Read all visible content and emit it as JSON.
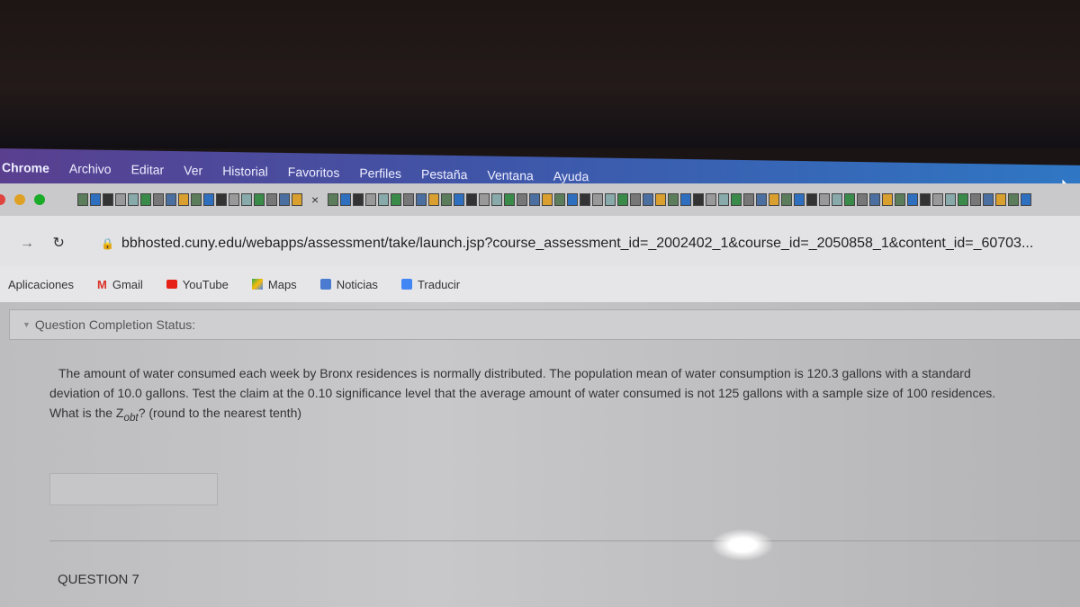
{
  "menubar": {
    "app": "Chrome",
    "items": [
      "Archivo",
      "Editar",
      "Ver",
      "Historial",
      "Favoritos",
      "Perfiles",
      "Pestaña",
      "Ventana",
      "Ayuda"
    ]
  },
  "tabs": {
    "close_label": "×"
  },
  "address": {
    "url": "bbhosted.cuny.edu/webapps/assessment/take/launch.jsp?course_assessment_id=_2002402_1&course_id=_2050858_1&content_id=_60703..."
  },
  "bookmarks": [
    {
      "label": "Aplicaciones",
      "icon": "apps-icon"
    },
    {
      "label": "Gmail",
      "icon": "gmail-icon",
      "color": "#d93025"
    },
    {
      "label": "YouTube",
      "icon": "youtube-icon",
      "color": "#e62117"
    },
    {
      "label": "Maps",
      "icon": "maps-icon",
      "color": "#34a853"
    },
    {
      "label": "Noticias",
      "icon": "news-icon",
      "color": "#4a7bd0"
    },
    {
      "label": "Traducir",
      "icon": "translate-icon",
      "color": "#4285f4"
    }
  ],
  "content": {
    "status_label": "Question Completion Status:",
    "question_p1": "The amount of water consumed each week by Bronx residences is normally distributed. The population mean of water consumption is 120.3 gallons with a standard deviation of 10.0 gallons. Test the claim at the 0.10 significance level that the average amount of water consumed is not 125 gallons with a sample size of 100 residences.",
    "question_p2_pre": "What is the Z",
    "question_p2_sub": "obt",
    "question_p2_post": "? (round to the nearest tenth)",
    "answer_value": "",
    "next_question": "QUESTION 7"
  }
}
